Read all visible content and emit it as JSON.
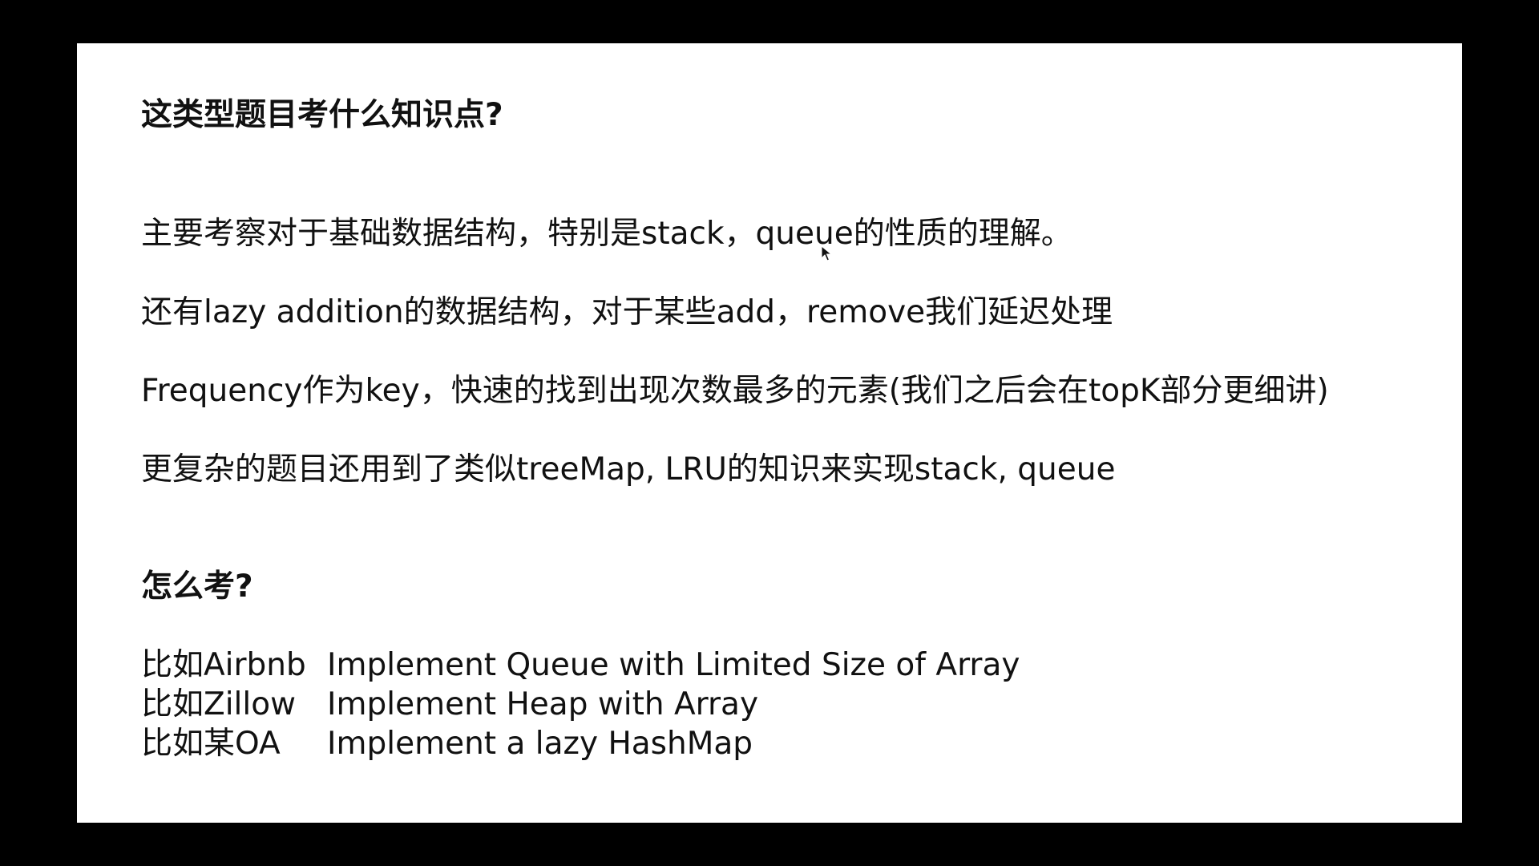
{
  "colors": {
    "background": "#000000",
    "slide": "#ffffff",
    "text": "#111111"
  },
  "slide": {
    "heading_1": "这类型题目考什么知识点?",
    "line_1": "主要考察对于基础数据结构，特别是stack，queue的性质的理解。",
    "line_2": "还有lazy addition的数据结构，对于某些add，remove我们延迟处理",
    "line_3": "Frequency作为key，快速的找到出现次数最多的元素(我们之后会在topK部分更细讲)",
    "line_4": "更复杂的题目还用到了类似treeMap, LRU的知识来实现stack, queue",
    "heading_2": "怎么考?",
    "examples": [
      {
        "prefix": "比如Airbnb",
        "text": "Implement Queue with Limited Size of Array"
      },
      {
        "prefix": "比如Zillow",
        "text": "Implement Heap with Array"
      },
      {
        "prefix": "比如某OA",
        "text": "Implement a lazy HashMap"
      }
    ]
  },
  "icons": {
    "cursor": "mouse-pointer-icon"
  }
}
